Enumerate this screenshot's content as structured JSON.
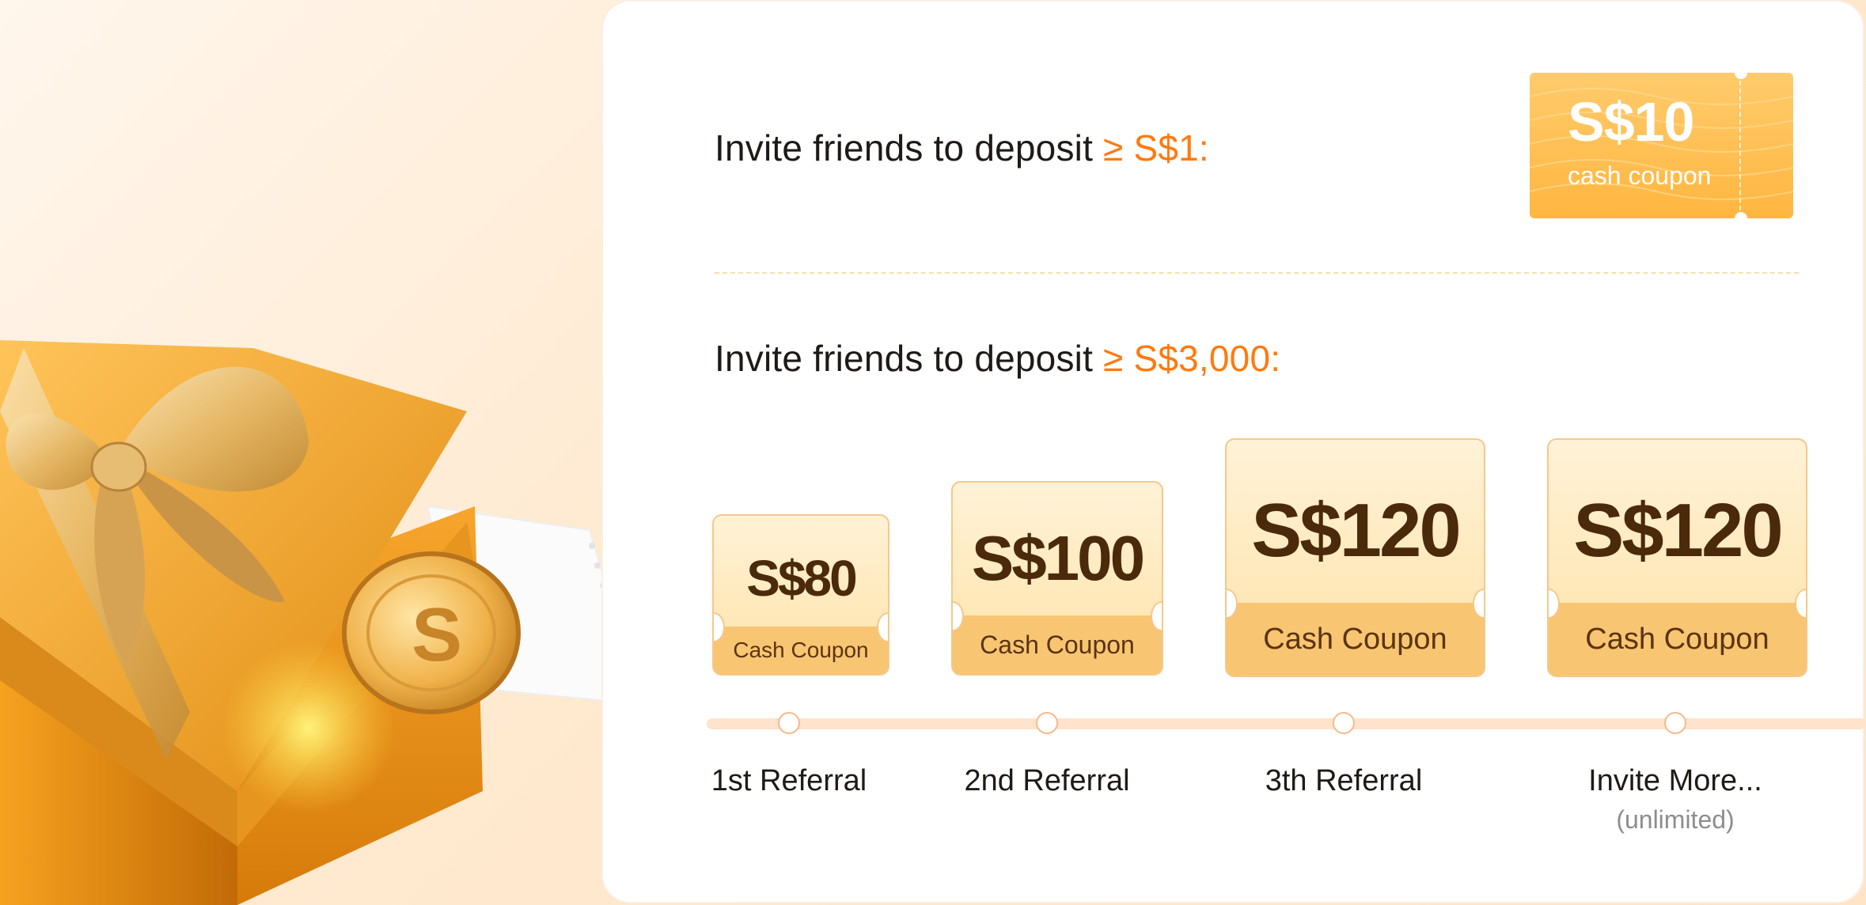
{
  "colors": {
    "accent": "#ff7a0f",
    "coupon_gold": "#ffb640",
    "coupon_text_dark": "#4a2a0a",
    "timeline": "#ffe3cd"
  },
  "hero": {
    "image": "gift-box-with-coin-illustration"
  },
  "section1": {
    "text": "Invite friends to deposit",
    "highlight": "≥ S$1:",
    "coupon": {
      "amount": "S$10",
      "label": "cash coupon"
    }
  },
  "section2": {
    "text": "Invite friends to deposit",
    "highlight": "≥ S$3,000:",
    "tiers": [
      {
        "amount": "S$80",
        "label": "Cash Coupon",
        "step": "1st Referral",
        "note": ""
      },
      {
        "amount": "S$100",
        "label": "Cash Coupon",
        "step": "2nd Referral",
        "note": ""
      },
      {
        "amount": "S$120",
        "label": "Cash Coupon",
        "step": "3th Referral",
        "note": ""
      },
      {
        "amount": "S$120",
        "label": "Cash Coupon",
        "step": "Invite More...",
        "note": "(unlimited)"
      }
    ]
  }
}
